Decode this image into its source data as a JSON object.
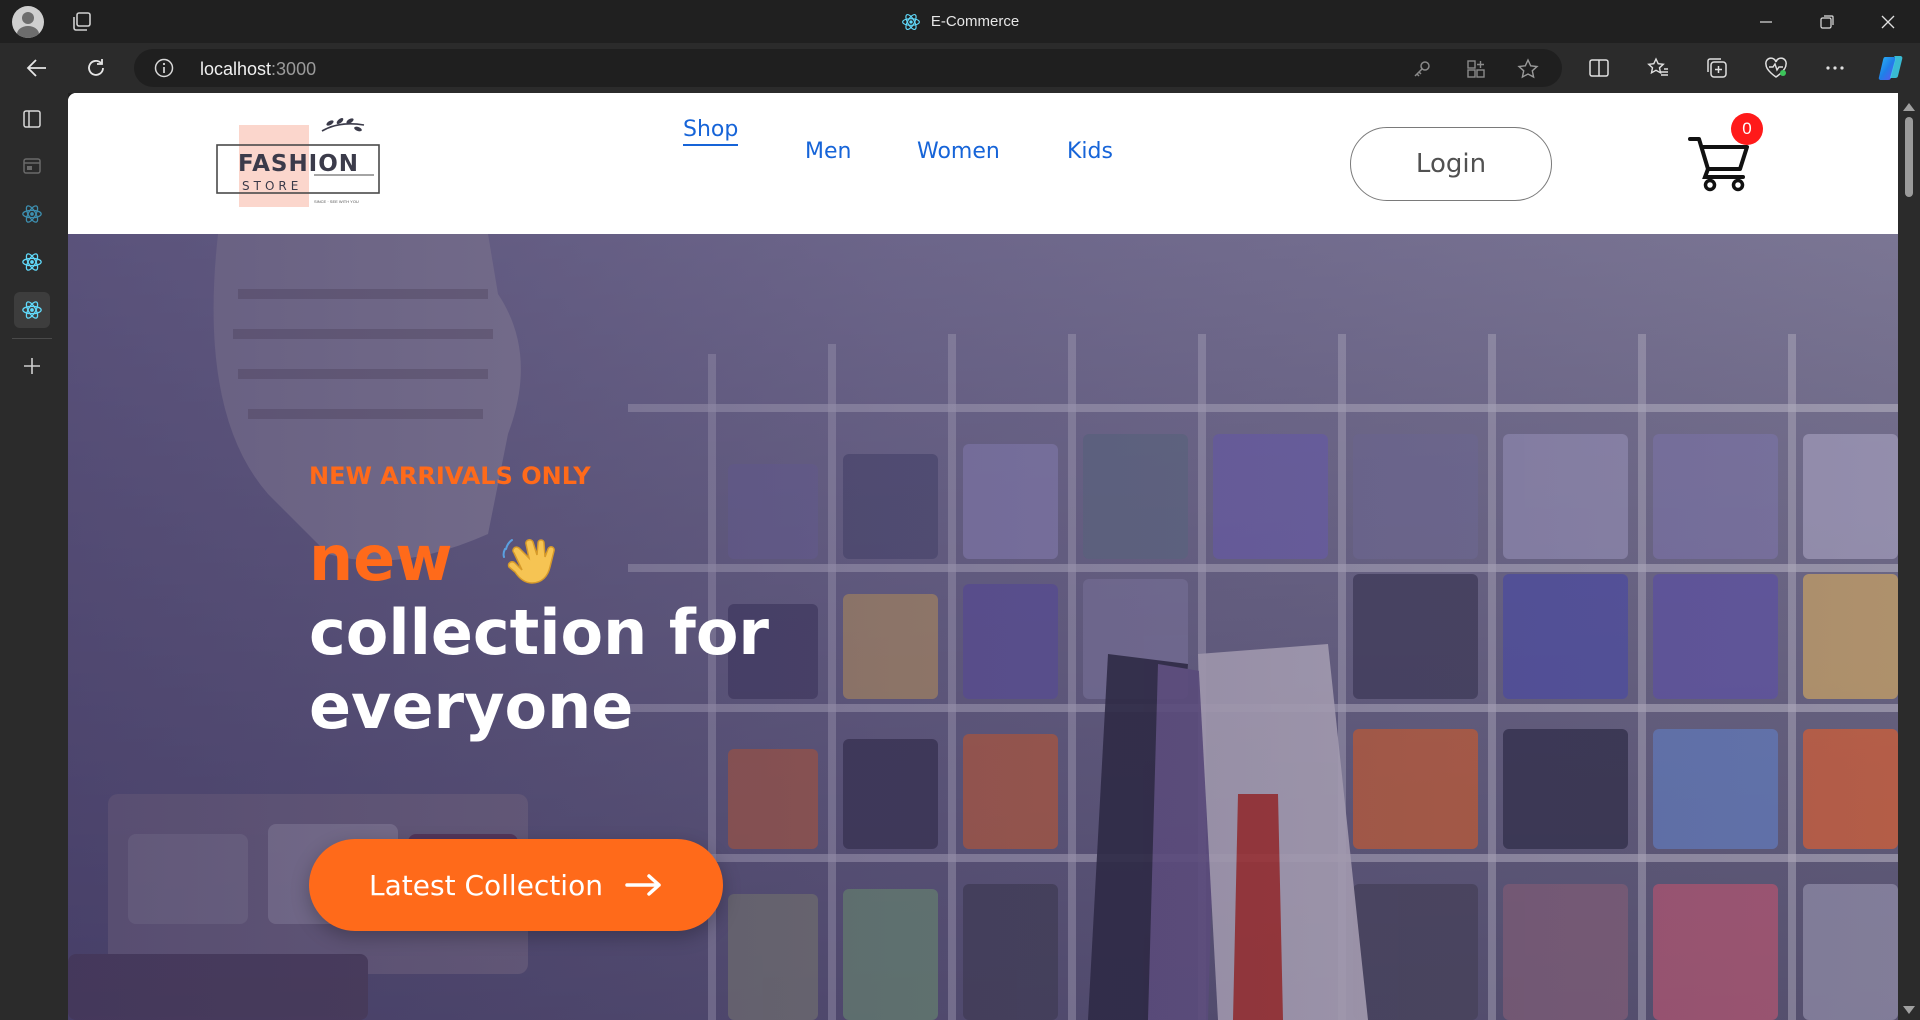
{
  "browser": {
    "window_title": "E-Commerce",
    "url_host": "localhost",
    "url_port": ":3000"
  },
  "site": {
    "logo": {
      "brand": "FASHION",
      "sub": "STORE",
      "tagline": "SINCE · SEE WITH YOU"
    },
    "nav": {
      "items": [
        {
          "label": "Shop",
          "active": true
        },
        {
          "label": "Men",
          "active": false
        },
        {
          "label": "Women",
          "active": false
        },
        {
          "label": "Kids",
          "active": false
        }
      ],
      "login_label": "Login",
      "cart_count": "0"
    },
    "hero": {
      "eyebrow": "NEW ARRIVALS ONLY",
      "headline_accent": "new",
      "headline_line2": "collection for",
      "headline_line3": "everyone",
      "cta_label": "Latest Collection"
    }
  },
  "colors": {
    "accent": "#ff6a1a",
    "link": "#1664d8",
    "badge": "#ff1a1a"
  },
  "icons": [
    "profile-icon",
    "tab-actions-icon",
    "back-icon",
    "refresh-icon",
    "info-icon",
    "key-icon",
    "apps-icon",
    "star-icon",
    "split-screen-icon",
    "favorites-icon",
    "collections-icon",
    "browser-essentials-icon",
    "more-icon",
    "copilot-icon",
    "cart-icon",
    "waving-hand-icon",
    "arrow-right-icon",
    "react-icon"
  ]
}
